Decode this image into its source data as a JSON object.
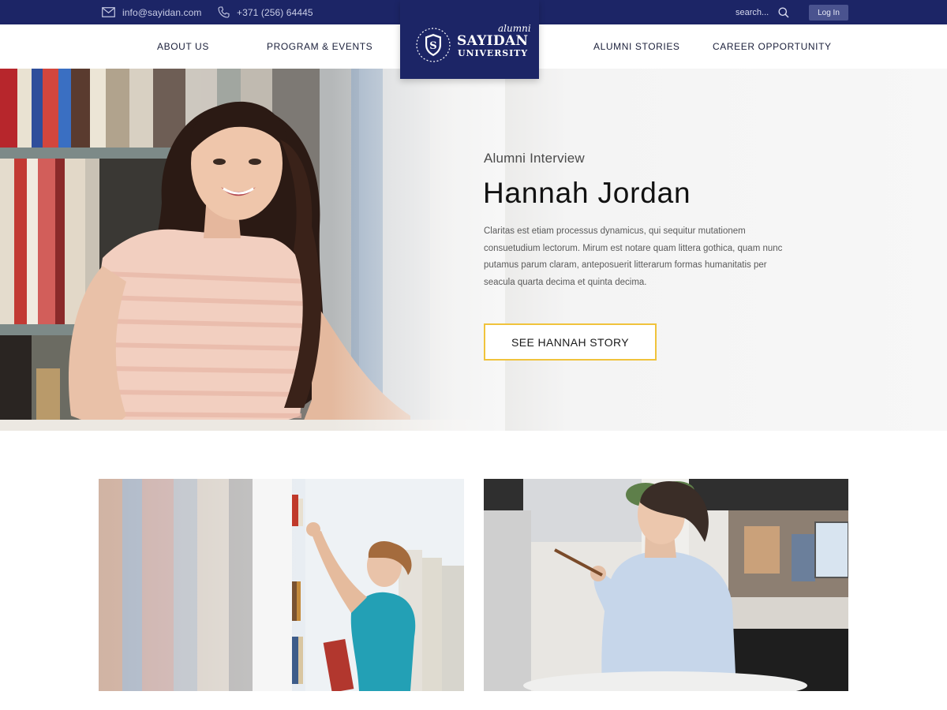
{
  "topbar": {
    "email": "info@sayidan.com",
    "email_icon": "mail-icon",
    "phone": "+371 (256) 64445",
    "phone_icon": "phone-icon",
    "search_placeholder": "search...",
    "search_icon": "search-icon",
    "login_label": "Log In"
  },
  "nav": {
    "about": "ABOUT US",
    "program": "PROGRAM & EVENTS",
    "stories": "ALUMNI STORIES",
    "career": "CAREER OPPORTUNITY"
  },
  "logo": {
    "tag": "alumni",
    "name_line1": "SAYIDAN",
    "name_line2": "UNIVERSITY",
    "emblem_letter": "S"
  },
  "hero": {
    "kicker": "Alumni Interview",
    "title": "Hannah Jordan",
    "text": "Claritas est etiam processus dynamicus, qui sequitur mutationem consuetudium lectorum. Mirum est notare quam littera gothica, quam nunc putamus parum claram, anteposuerit litterarum formas humanitatis per seacula quarta decima et quinta decima.",
    "cta_label": "SEE HANNAH STORY"
  },
  "colors": {
    "navy": "#1c2566",
    "accent_yellow": "#f0c33c",
    "login_button": "#4a538f"
  }
}
